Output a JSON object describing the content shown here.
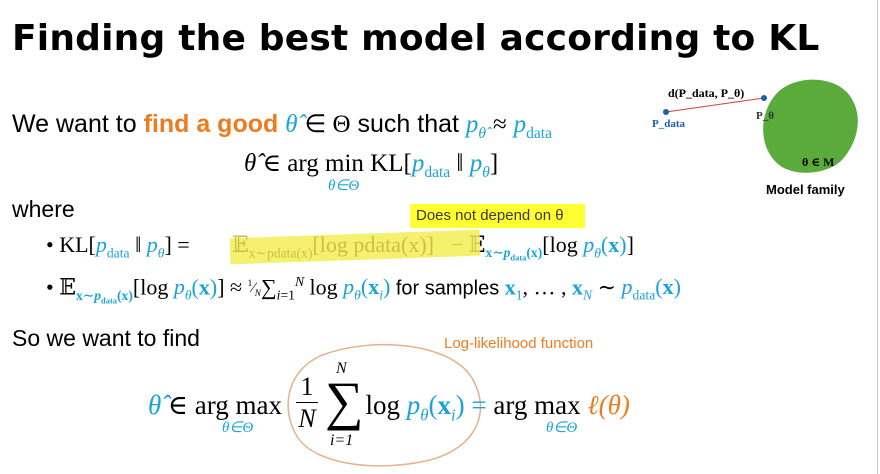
{
  "title": "Finding the best model according to KL",
  "line1": {
    "prefix": "We want to",
    "highlight": "find a good",
    "suffix": "such that"
  },
  "argmin": {
    "op": "arg min",
    "sub": "θ∈Θ",
    "kl": "KL"
  },
  "where": "where",
  "note": "Does not depend on θ",
  "bullet2_text": "for samples",
  "so_we_want": "So we want to find",
  "annotation": "Log-likelihood function",
  "argmax": {
    "op": "arg max",
    "sub": "θ∈Θ"
  },
  "figure": {
    "distance_label": "d(P_data, P_θ)",
    "p_data_label": "P_data",
    "p_theta_label": "P_θ",
    "set_label": "θ ∈ M",
    "caption": "Model family"
  },
  "colors": {
    "accent_cyan": "#1aa3d9",
    "accent_orange": "#ee7c1f",
    "highlight_yellow": "#ffff33",
    "blob_green": "#5aaa3c",
    "line_red": "#d43b3b",
    "dot_blue": "#1a5fb4"
  }
}
